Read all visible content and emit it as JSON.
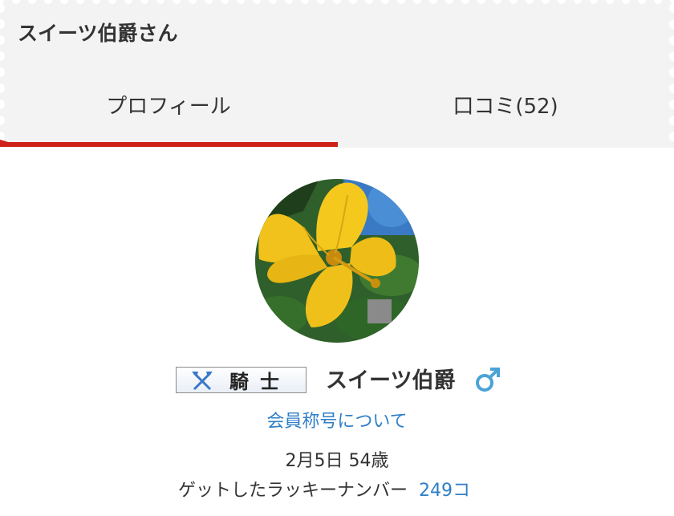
{
  "header": {
    "title": "スイーツ伯爵さん"
  },
  "tabs": [
    {
      "label": "プロフィール",
      "active": true
    },
    {
      "label": "口コミ(52)",
      "active": false
    }
  ],
  "colors": {
    "accent": "#d0201a",
    "link": "#2f7fc7",
    "gender": "#4aa3d6",
    "panel_bg": "#f3f3f3"
  },
  "profile": {
    "avatar_icon": "hibiscus-flower-photo",
    "rank_label": "騎士",
    "rank_icon": "crossed-axes-icon",
    "name": "スイーツ伯爵",
    "gender_icon": "male-symbol-icon",
    "title_link": "会員称号について",
    "birth_age": "2月5日 54歳",
    "lucky_label": "ゲットしたラッキーナンバー",
    "lucky_count": "249コ"
  }
}
